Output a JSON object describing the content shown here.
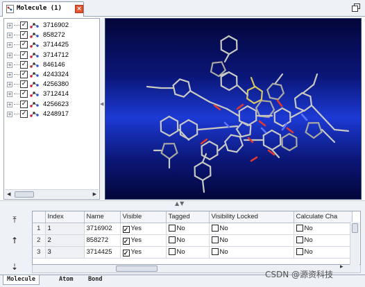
{
  "tab": {
    "title": "Molecule (1)",
    "close_glyph": "×",
    "icon": "molecule-tab-icon"
  },
  "window": {
    "restore_icon": "restore-window-icon"
  },
  "tree": {
    "items": [
      {
        "label": "3716902",
        "checked": true
      },
      {
        "label": "858272",
        "checked": true
      },
      {
        "label": "3714425",
        "checked": true
      },
      {
        "label": "3714712",
        "checked": true
      },
      {
        "label": "846146",
        "checked": true
      },
      {
        "label": "4243324",
        "checked": true
      },
      {
        "label": "4256380",
        "checked": true
      },
      {
        "label": "3712414",
        "checked": true
      },
      {
        "label": "4256623",
        "checked": true
      },
      {
        "label": "4248917",
        "checked": true
      }
    ],
    "expander_glyph": "+",
    "check_glyph": "✓"
  },
  "viewer": {
    "description_icon": "molecule-3d-view"
  },
  "table": {
    "columns": [
      "Index",
      "Name",
      "Visible",
      "Tagged",
      "Visibility Locked",
      "Calculate Cha"
    ],
    "rows": [
      {
        "num": "1",
        "index": "1",
        "name": "3716902",
        "visible": "Yes",
        "tagged": "No",
        "locked": "No",
        "calc": "No"
      },
      {
        "num": "2",
        "index": "2",
        "name": "858272",
        "visible": "Yes",
        "tagged": "No",
        "locked": "No",
        "calc": "No"
      },
      {
        "num": "3",
        "index": "3",
        "name": "3714425",
        "visible": "Yes",
        "tagged": "No",
        "locked": "No",
        "calc": "No"
      }
    ]
  },
  "side_tools": {
    "top_glyph": "⤒",
    "up_glyph": "↑",
    "down_glyph": "⇣"
  },
  "bottom_tabs": [
    "Molecule",
    "Atom",
    "Bond"
  ],
  "watermark": "CSDN @源资科技"
}
